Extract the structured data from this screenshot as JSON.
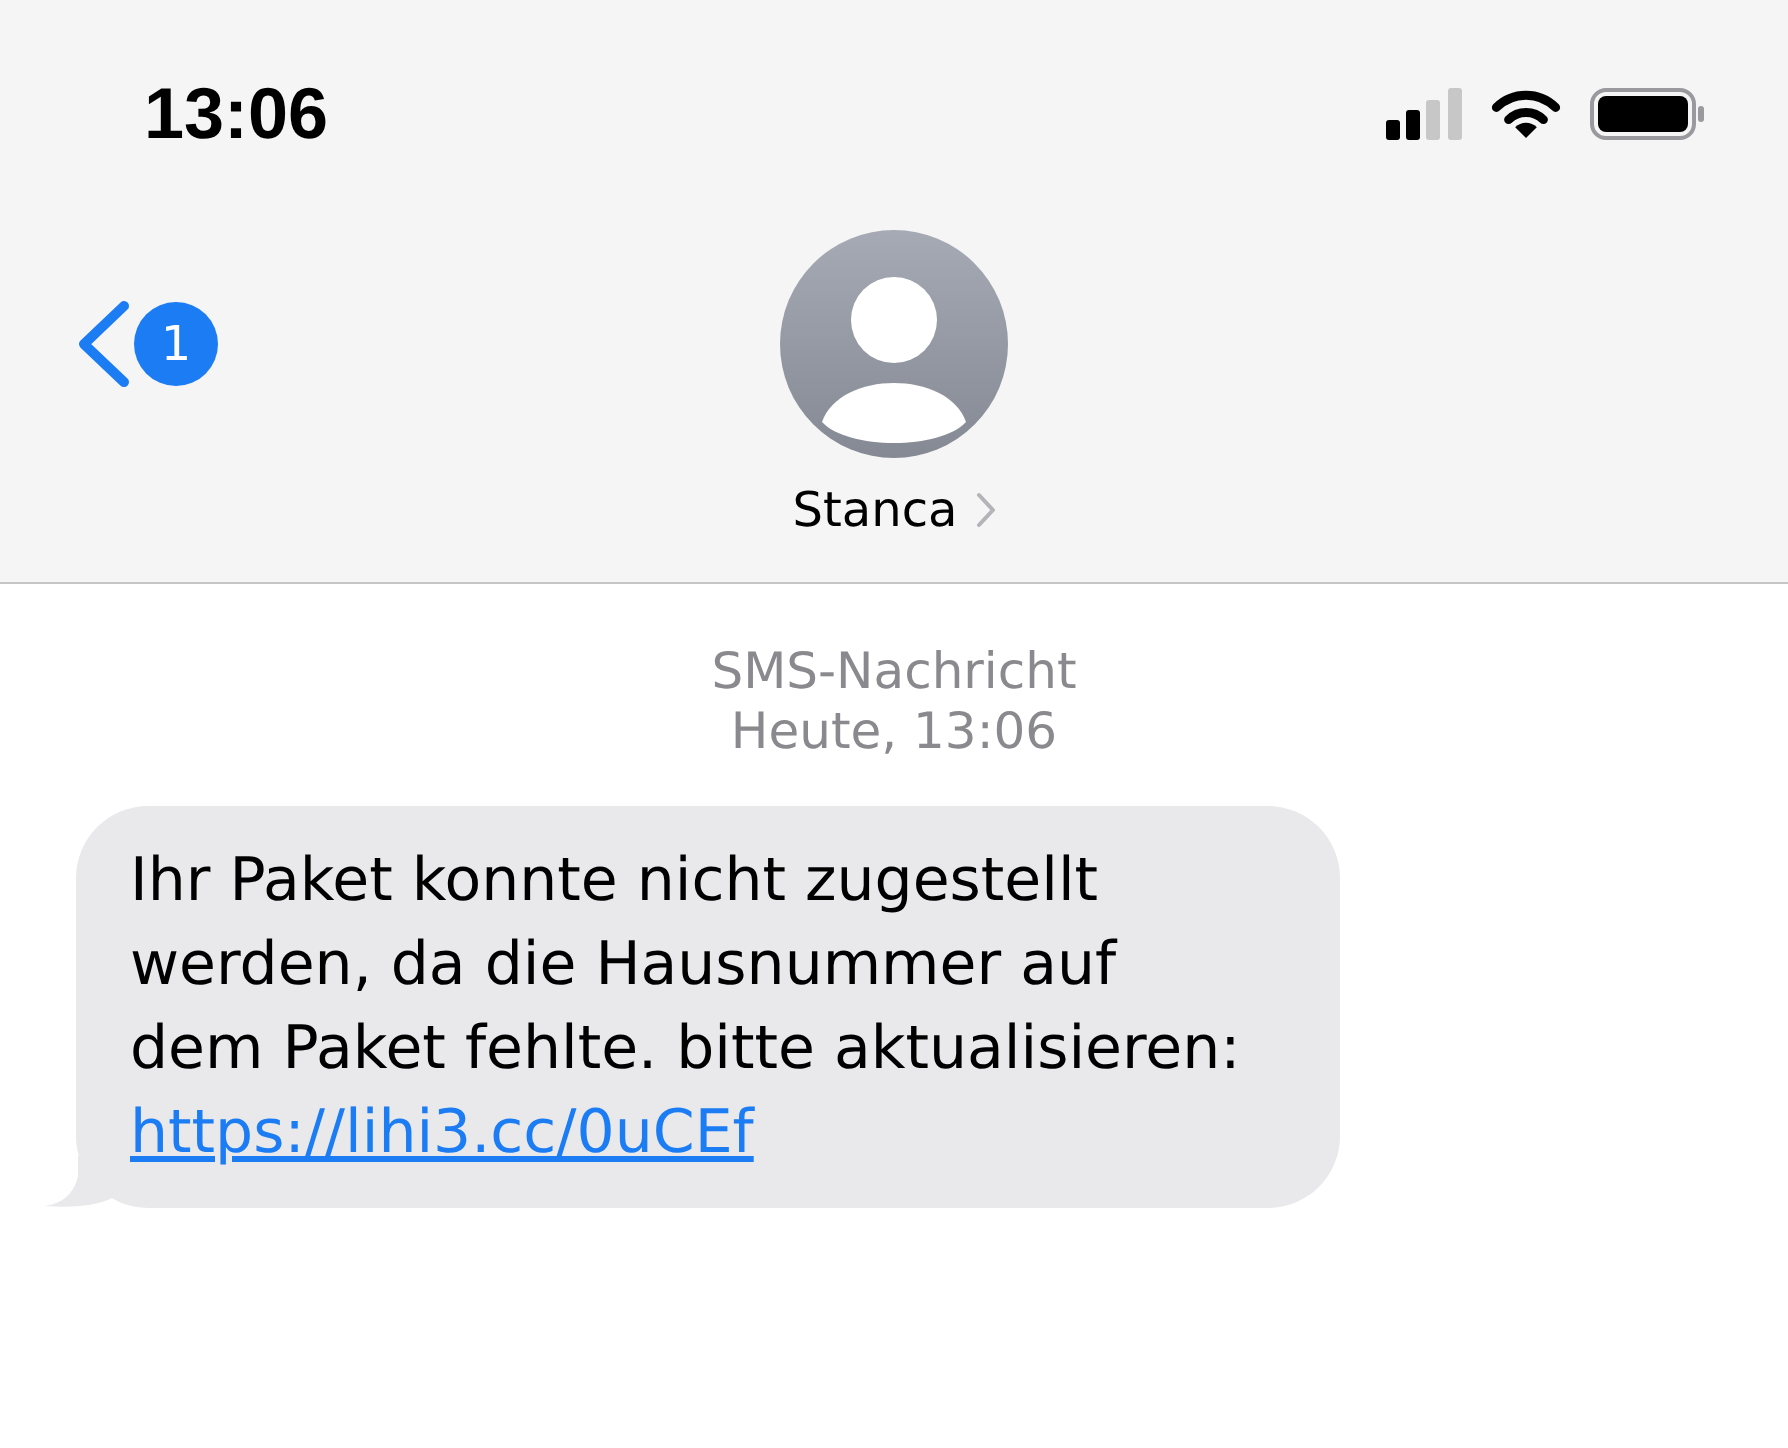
{
  "status_bar": {
    "time": "13:06"
  },
  "nav": {
    "back_badge": "1",
    "contact": {
      "name": "Stanca"
    }
  },
  "conversation": {
    "service": "SMS-Nachricht",
    "timestamp": "Heute, 13:06",
    "messages": [
      {
        "kind": "incoming",
        "text": "Ihr Paket konnte nicht zugestellt werden, da die Hausnummer auf dem Paket fehlte. bitte aktualisieren:",
        "link": "https://lihi3.cc/0uCEf"
      }
    ]
  }
}
